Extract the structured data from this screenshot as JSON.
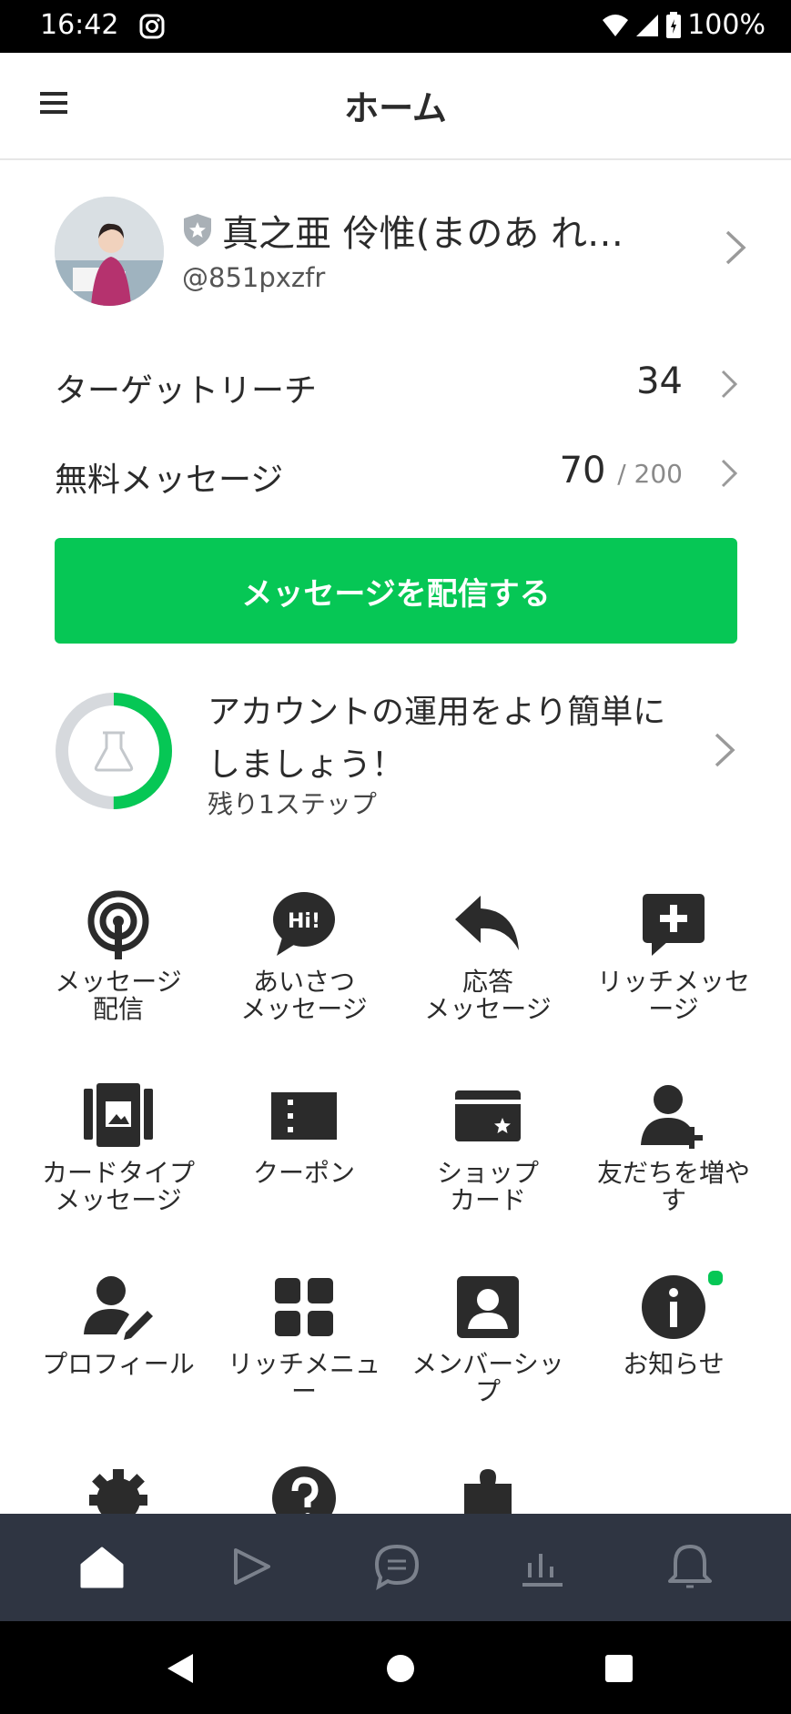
{
  "status_bar": {
    "time": "16:42",
    "battery": "100%"
  },
  "header": {
    "title": "ホーム"
  },
  "profile": {
    "name": "真之亜 伶惟(まのあ れ…",
    "id": "@851pxzfr"
  },
  "stats": {
    "reach": {
      "label": "ターゲットリーチ",
      "value": "34"
    },
    "free_messages": {
      "label": "無料メッセージ",
      "value": "70",
      "limit": "/ 200"
    }
  },
  "cta": {
    "label": "メッセージを配信する"
  },
  "setup": {
    "message": "アカウントの運用をより簡単にしましょう！",
    "remaining": "残り1ステップ",
    "progress": 0.5
  },
  "features": [
    {
      "label": "メッセージ\n配信",
      "icon": "broadcast-icon"
    },
    {
      "label": "あいさつ\nメッセージ",
      "icon": "greeting-hi-icon"
    },
    {
      "label": "応答\nメッセージ",
      "icon": "reply-icon"
    },
    {
      "label": "リッチメッセ\nージ",
      "icon": "rich-message-icon"
    },
    {
      "label": "カードタイプ\nメッセージ",
      "icon": "card-type-icon"
    },
    {
      "label": "クーポン",
      "icon": "coupon-icon"
    },
    {
      "label": "ショップ\nカード",
      "icon": "shop-card-icon"
    },
    {
      "label": "友だちを増や\nす",
      "icon": "add-friend-icon"
    },
    {
      "label": "プロフィール",
      "icon": "profile-edit-icon"
    },
    {
      "label": "リッチメニュ\nー",
      "icon": "rich-menu-icon"
    },
    {
      "label": "メンバーシッ\nプ",
      "icon": "membership-icon"
    },
    {
      "label": "お知らせ",
      "icon": "info-icon"
    }
  ],
  "colors": {
    "accent": "#06c755",
    "nav_bg": "#2f3542",
    "icon": "#2b2b2b"
  }
}
